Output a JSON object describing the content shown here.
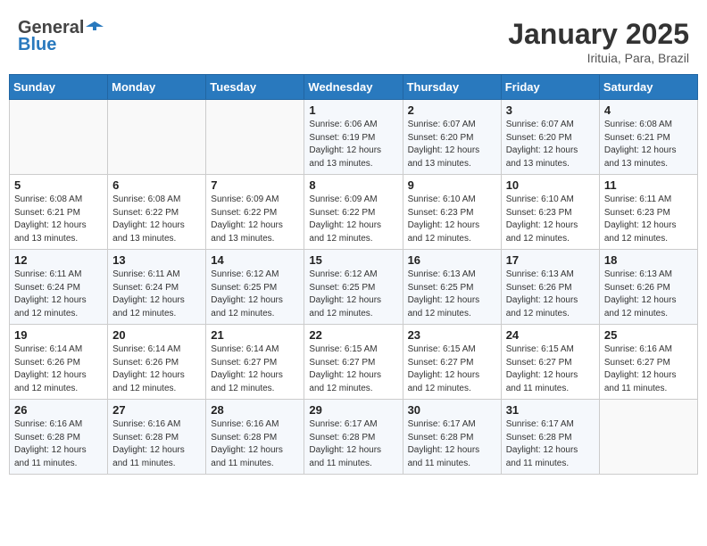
{
  "header": {
    "logo_line1": "General",
    "logo_line2": "Blue",
    "title": "January 2025",
    "subtitle": "Irituia, Para, Brazil"
  },
  "weekdays": [
    "Sunday",
    "Monday",
    "Tuesday",
    "Wednesday",
    "Thursday",
    "Friday",
    "Saturday"
  ],
  "weeks": [
    [
      {
        "day": "",
        "info": ""
      },
      {
        "day": "",
        "info": ""
      },
      {
        "day": "",
        "info": ""
      },
      {
        "day": "1",
        "info": "Sunrise: 6:06 AM\nSunset: 6:19 PM\nDaylight: 12 hours\nand 13 minutes."
      },
      {
        "day": "2",
        "info": "Sunrise: 6:07 AM\nSunset: 6:20 PM\nDaylight: 12 hours\nand 13 minutes."
      },
      {
        "day": "3",
        "info": "Sunrise: 6:07 AM\nSunset: 6:20 PM\nDaylight: 12 hours\nand 13 minutes."
      },
      {
        "day": "4",
        "info": "Sunrise: 6:08 AM\nSunset: 6:21 PM\nDaylight: 12 hours\nand 13 minutes."
      }
    ],
    [
      {
        "day": "5",
        "info": "Sunrise: 6:08 AM\nSunset: 6:21 PM\nDaylight: 12 hours\nand 13 minutes."
      },
      {
        "day": "6",
        "info": "Sunrise: 6:08 AM\nSunset: 6:22 PM\nDaylight: 12 hours\nand 13 minutes."
      },
      {
        "day": "7",
        "info": "Sunrise: 6:09 AM\nSunset: 6:22 PM\nDaylight: 12 hours\nand 13 minutes."
      },
      {
        "day": "8",
        "info": "Sunrise: 6:09 AM\nSunset: 6:22 PM\nDaylight: 12 hours\nand 12 minutes."
      },
      {
        "day": "9",
        "info": "Sunrise: 6:10 AM\nSunset: 6:23 PM\nDaylight: 12 hours\nand 12 minutes."
      },
      {
        "day": "10",
        "info": "Sunrise: 6:10 AM\nSunset: 6:23 PM\nDaylight: 12 hours\nand 12 minutes."
      },
      {
        "day": "11",
        "info": "Sunrise: 6:11 AM\nSunset: 6:23 PM\nDaylight: 12 hours\nand 12 minutes."
      }
    ],
    [
      {
        "day": "12",
        "info": "Sunrise: 6:11 AM\nSunset: 6:24 PM\nDaylight: 12 hours\nand 12 minutes."
      },
      {
        "day": "13",
        "info": "Sunrise: 6:11 AM\nSunset: 6:24 PM\nDaylight: 12 hours\nand 12 minutes."
      },
      {
        "day": "14",
        "info": "Sunrise: 6:12 AM\nSunset: 6:25 PM\nDaylight: 12 hours\nand 12 minutes."
      },
      {
        "day": "15",
        "info": "Sunrise: 6:12 AM\nSunset: 6:25 PM\nDaylight: 12 hours\nand 12 minutes."
      },
      {
        "day": "16",
        "info": "Sunrise: 6:13 AM\nSunset: 6:25 PM\nDaylight: 12 hours\nand 12 minutes."
      },
      {
        "day": "17",
        "info": "Sunrise: 6:13 AM\nSunset: 6:26 PM\nDaylight: 12 hours\nand 12 minutes."
      },
      {
        "day": "18",
        "info": "Sunrise: 6:13 AM\nSunset: 6:26 PM\nDaylight: 12 hours\nand 12 minutes."
      }
    ],
    [
      {
        "day": "19",
        "info": "Sunrise: 6:14 AM\nSunset: 6:26 PM\nDaylight: 12 hours\nand 12 minutes."
      },
      {
        "day": "20",
        "info": "Sunrise: 6:14 AM\nSunset: 6:26 PM\nDaylight: 12 hours\nand 12 minutes."
      },
      {
        "day": "21",
        "info": "Sunrise: 6:14 AM\nSunset: 6:27 PM\nDaylight: 12 hours\nand 12 minutes."
      },
      {
        "day": "22",
        "info": "Sunrise: 6:15 AM\nSunset: 6:27 PM\nDaylight: 12 hours\nand 12 minutes."
      },
      {
        "day": "23",
        "info": "Sunrise: 6:15 AM\nSunset: 6:27 PM\nDaylight: 12 hours\nand 12 minutes."
      },
      {
        "day": "24",
        "info": "Sunrise: 6:15 AM\nSunset: 6:27 PM\nDaylight: 12 hours\nand 11 minutes."
      },
      {
        "day": "25",
        "info": "Sunrise: 6:16 AM\nSunset: 6:27 PM\nDaylight: 12 hours\nand 11 minutes."
      }
    ],
    [
      {
        "day": "26",
        "info": "Sunrise: 6:16 AM\nSunset: 6:28 PM\nDaylight: 12 hours\nand 11 minutes."
      },
      {
        "day": "27",
        "info": "Sunrise: 6:16 AM\nSunset: 6:28 PM\nDaylight: 12 hours\nand 11 minutes."
      },
      {
        "day": "28",
        "info": "Sunrise: 6:16 AM\nSunset: 6:28 PM\nDaylight: 12 hours\nand 11 minutes."
      },
      {
        "day": "29",
        "info": "Sunrise: 6:17 AM\nSunset: 6:28 PM\nDaylight: 12 hours\nand 11 minutes."
      },
      {
        "day": "30",
        "info": "Sunrise: 6:17 AM\nSunset: 6:28 PM\nDaylight: 12 hours\nand 11 minutes."
      },
      {
        "day": "31",
        "info": "Sunrise: 6:17 AM\nSunset: 6:28 PM\nDaylight: 12 hours\nand 11 minutes."
      },
      {
        "day": "",
        "info": ""
      }
    ]
  ]
}
